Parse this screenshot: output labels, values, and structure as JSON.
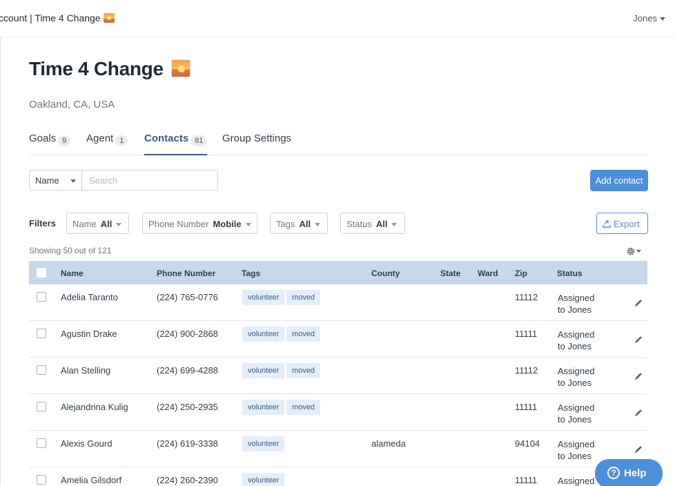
{
  "header": {
    "breadcrumb": "ccount | Time 4 Change",
    "user_menu": "Jones"
  },
  "page": {
    "title": "Time 4 Change",
    "location": "Oakland, CA, USA"
  },
  "tabs": [
    {
      "label": "Goals",
      "count": "9"
    },
    {
      "label": "Agent",
      "count": "1"
    },
    {
      "label": "Contacts",
      "count": "81"
    },
    {
      "label": "Group Settings",
      "count": ""
    }
  ],
  "search": {
    "field": "Name",
    "placeholder": "Search"
  },
  "actions": {
    "add_contact": "Add contact",
    "export": "Export"
  },
  "filters": {
    "label": "Filters",
    "items": [
      {
        "name": "Name",
        "value": "All"
      },
      {
        "name": "Phone Number",
        "value": "Mobile"
      },
      {
        "name": "Tags",
        "value": "All"
      },
      {
        "name": "Status",
        "value": "All"
      }
    ]
  },
  "showing": "Showing 50 out of 121",
  "table": {
    "columns": [
      "Name",
      "Phone Number",
      "Tags",
      "County",
      "State",
      "Ward",
      "Zip",
      "Status"
    ],
    "rows": [
      {
        "name": "Adelia Taranto",
        "phone": "(224) 765-0776",
        "tags": [
          "volunteer",
          "moved"
        ],
        "county": "",
        "state": "",
        "ward": "",
        "zip": "11112",
        "status_line1": "Assigned",
        "status_line2": "to Jones"
      },
      {
        "name": "Agustin Drake",
        "phone": "(224) 900-2868",
        "tags": [
          "volunteer",
          "moved"
        ],
        "county": "",
        "state": "",
        "ward": "",
        "zip": "11111",
        "status_line1": "Assigned",
        "status_line2": "to Jones"
      },
      {
        "name": "Alan Stelling",
        "phone": "(224) 699-4288",
        "tags": [
          "volunteer",
          "moved"
        ],
        "county": "",
        "state": "",
        "ward": "",
        "zip": "11112",
        "status_line1": "Assigned",
        "status_line2": "to Jones"
      },
      {
        "name": "Alejandrina Kulig",
        "phone": "(224) 250-2935",
        "tags": [
          "volunteer",
          "moved"
        ],
        "county": "",
        "state": "",
        "ward": "",
        "zip": "11111",
        "status_line1": "Assigned",
        "status_line2": "to Jones"
      },
      {
        "name": "Alexis Gourd",
        "phone": "(224) 619-3338",
        "tags": [
          "volunteer"
        ],
        "county": "alameda",
        "state": "",
        "ward": "",
        "zip": "94104",
        "status_line1": "Assigned",
        "status_line2": "to Jones"
      },
      {
        "name": "Amelia Gilsdorf",
        "phone": "(224) 260-2390",
        "tags": [
          "volunteer"
        ],
        "county": "",
        "state": "",
        "ward": "",
        "zip": "11111",
        "status_line1": "Assigned",
        "status_line2": ""
      }
    ]
  },
  "help": {
    "label": "Help"
  },
  "colors": {
    "accent": "#4d8fd9",
    "table_header": "#c8d8ec",
    "tag_bg": "#e3eef9",
    "tab_active": "#3c5a80"
  }
}
